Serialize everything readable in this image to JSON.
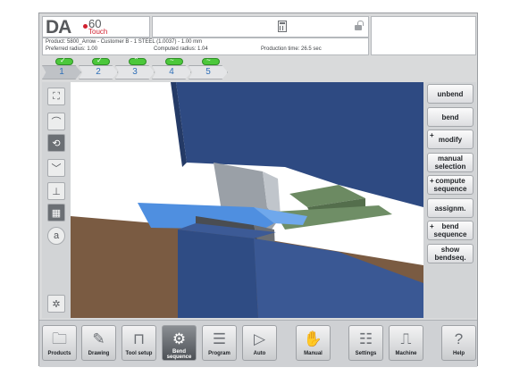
{
  "header": {
    "logo_text": "DA",
    "logo_model": "60",
    "logo_sub": "Touch",
    "icons": [
      "calculator-icon",
      "lock-open-icon"
    ]
  },
  "info": {
    "product_line": "Product: 5800_Arrow - Customer B - 1 STEEL (1.0037) - 1.00 mm",
    "preferred_radius": "Preferred radius: 1.00",
    "computed_radius": "Computed radius: 1.04",
    "production_time": "Production time: 26.5 sec"
  },
  "steps": [
    {
      "num": "1",
      "badge": "✓",
      "active": true
    },
    {
      "num": "2",
      "badge": "✓",
      "active": false
    },
    {
      "num": "3",
      "badge": "⌃",
      "active": false
    },
    {
      "num": "4",
      "badge": "~",
      "active": false
    },
    {
      "num": "5",
      "badge": "~",
      "active": false
    }
  ],
  "left_toolbar": {
    "icons": [
      "zoom-fit-icon",
      "bend-view-icon",
      "rotate-view-icon",
      "collapse-icon",
      "backgauge-icon",
      "tool-view-icon",
      "auto-label-icon",
      "settings-sun-icon"
    ],
    "auto_label": "a"
  },
  "right_buttons": {
    "unbend": "unbend",
    "bend": "bend",
    "modify": "modify",
    "manual_selection": "manual selection",
    "compute_sequence": "compute sequence",
    "assignm": "assignm.",
    "bend_sequence": "bend sequence",
    "show_bendseq": "show bendseq.",
    "plus": "+"
  },
  "bottom_nav": [
    {
      "label": "Products",
      "icon": "folder-icon",
      "active": false
    },
    {
      "label": "Drawing",
      "icon": "drawing-icon",
      "active": false
    },
    {
      "label": "Tool setup",
      "icon": "tool-setup-icon",
      "active": false
    },
    {
      "label": "Bend sequence",
      "icon": "bend-sequence-icon",
      "active": true
    },
    {
      "label": "Program",
      "icon": "program-icon",
      "active": false
    },
    {
      "label": "Auto",
      "icon": "play-icon",
      "active": false
    },
    {
      "label": "Manual",
      "icon": "hand-icon",
      "active": false
    },
    {
      "label": "Settings",
      "icon": "settings-icon",
      "active": false
    },
    {
      "label": "Machine",
      "icon": "machine-icon",
      "active": false
    },
    {
      "label": "Help",
      "icon": "help-icon",
      "active": false
    }
  ],
  "colors": {
    "accent_blue": "#2f6fb8",
    "badge_green": "#4cc83b",
    "logo_red": "#d11f2e",
    "press_blue": "#314e86",
    "sheet_blue": "#4f8fe0",
    "part_green": "#6c8a62",
    "floor_brown": "#7a5b42"
  }
}
